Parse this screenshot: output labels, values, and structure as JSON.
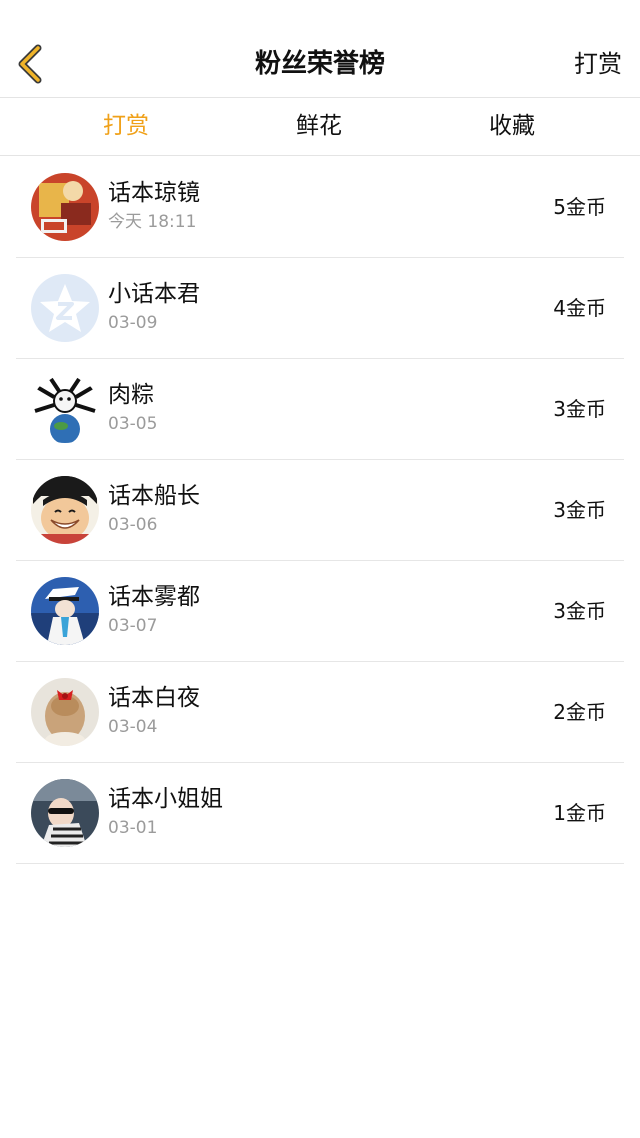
{
  "header": {
    "title": "粉丝荣誉榜",
    "action_label": "打赏",
    "accent_color": "#f0a119"
  },
  "tabs": [
    {
      "label": "打赏",
      "active": true
    },
    {
      "label": "鲜花",
      "active": false
    },
    {
      "label": "收藏",
      "active": false
    }
  ],
  "list": {
    "rows": [
      {
        "name": "话本琼镜",
        "date": "今天 18:11",
        "amount": "5金币"
      },
      {
        "name": "小话本君",
        "date": "03-09",
        "amount": "4金币"
      },
      {
        "name": "肉粽",
        "date": "03-05",
        "amount": "3金币"
      },
      {
        "name": "话本船长",
        "date": "03-06",
        "amount": "3金币"
      },
      {
        "name": "话本雾都",
        "date": "03-07",
        "amount": "3金币"
      },
      {
        "name": "话本白夜",
        "date": "03-04",
        "amount": "2金币"
      },
      {
        "name": "话本小姐姐",
        "date": "03-01",
        "amount": "1金币"
      }
    ]
  }
}
